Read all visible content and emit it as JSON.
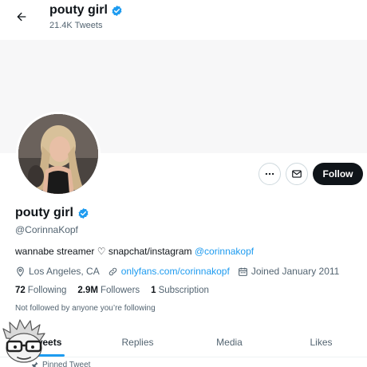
{
  "header": {
    "back_icon": "arrow-left-icon",
    "name": "pouty girl",
    "tweet_count": "21.4K Tweets",
    "verified_icon": "verified-badge-icon"
  },
  "profile": {
    "display_name": "pouty girl",
    "handle": "@CorinnaKopf",
    "bio_text": "wannabe streamer ♡ snapchat/instagram ",
    "bio_link": "@corinnakopf",
    "location": "Los Angeles, CA",
    "website": "onlyfans.com/corinnakopf",
    "joined": "Joined January 2011",
    "not_followed": "Not followed by anyone you’re following"
  },
  "stats": {
    "following_count": "72",
    "following_label": "Following",
    "followers_count": "2.9M",
    "followers_label": "Followers",
    "subscription_count": "1",
    "subscription_label": "Subscription"
  },
  "actions": {
    "more_icon": "more-dots-icon",
    "message_icon": "envelope-icon",
    "follow_label": "Follow"
  },
  "tabs": [
    {
      "label": "Tweets",
      "active": true
    },
    {
      "label": "Replies",
      "active": false
    },
    {
      "label": "Media",
      "active": false
    },
    {
      "label": "Likes",
      "active": false
    }
  ],
  "pinned": {
    "icon": "pin-icon",
    "label": "Pinned Tweet"
  },
  "colors": {
    "accent": "#1d9bf0",
    "text": "#0f1419",
    "muted": "#536471",
    "follow_bg": "#0f1419"
  }
}
